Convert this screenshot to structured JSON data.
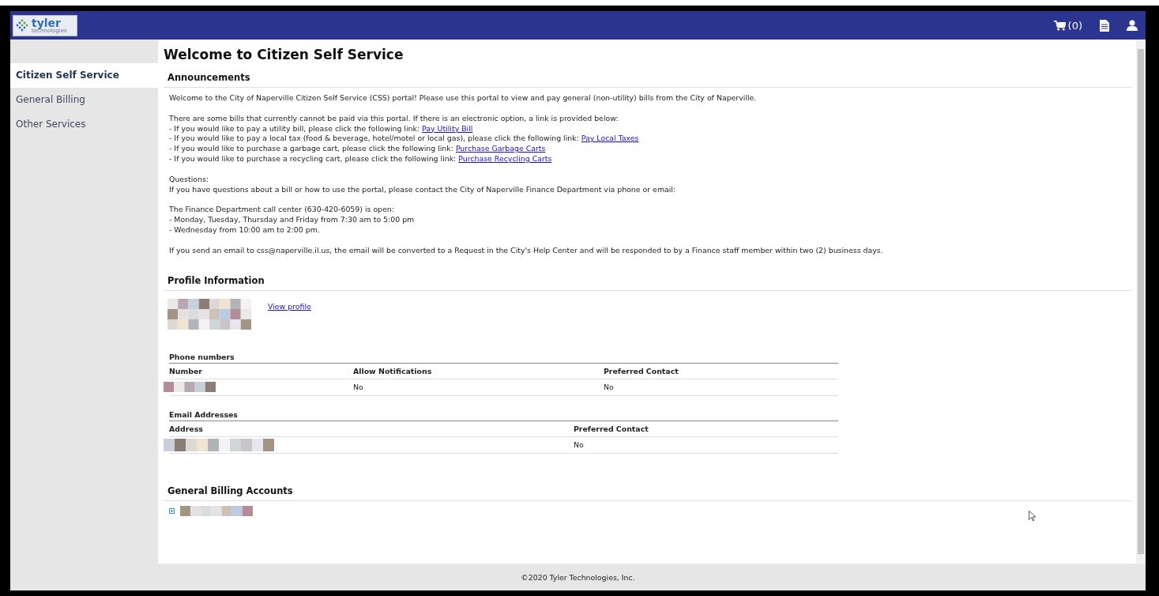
{
  "header": {
    "logo": "tyler",
    "logo_sub": "technologies",
    "cart_count": "(0)"
  },
  "sidebar": {
    "items": [
      {
        "label": "Citizen Self Service",
        "selected": true
      },
      {
        "label": "General Billing",
        "selected": false
      },
      {
        "label": "Other Services",
        "selected": false
      }
    ]
  },
  "page_title": "Welcome to Citizen Self Service",
  "announcements": {
    "heading": "Announcements",
    "paragraphs": [
      {
        "lines": [
          {
            "text": "Welcome to the City of Naperville Citizen Self Service (CSS) portal! Please use this portal to view and pay general (non-utility) bills from the City of Naperville."
          }
        ]
      },
      {
        "lines": [
          {
            "text": "There are some bills that currently cannot be paid via this portal. If there is an electronic option, a link is provided below:"
          },
          {
            "text": "- If you would like to pay a utility bill, please click the following link:",
            "link": "Pay Utility Bill"
          },
          {
            "text": "- If you would like to pay a local tax (food & beverage, hotel/motel or local gas), please click the following link:",
            "link": "Pay Local Taxes"
          },
          {
            "text": "- If you would like to purchase a garbage cart, please click the following link:",
            "link": "Purchase Garbage Carts"
          },
          {
            "text": "- If you would like to purchase a recycling cart, please click the following link:",
            "link": "Purchase Recycling Carts"
          }
        ]
      },
      {
        "lines": [
          {
            "text": "Questions:"
          },
          {
            "text": "If you have questions about a bill or how to use the portal, please contact the City of Naperville Finance Department via phone or email:"
          }
        ]
      },
      {
        "lines": [
          {
            "text": "The Finance Department call center (630-420-6059) is open:"
          },
          {
            "text": "- Monday, Tuesday, Thursday and Friday from 7:30 am to 5:00 pm"
          },
          {
            "text": "- Wednesday from 10:00 am to 2:00 pm."
          }
        ]
      },
      {
        "lines": [
          {
            "text": "If you send an email to css@naperville.il.us, the email will be converted to a Request in the City's Help Center and will be responded to by a Finance staff member within two (2) business days."
          }
        ]
      }
    ]
  },
  "profile": {
    "heading": "Profile Information",
    "view_link": "View profile",
    "phones": {
      "title": "Phone numbers",
      "columns": [
        "Number",
        "Allow Notifications",
        "Preferred Contact"
      ],
      "rows": [
        {
          "allow_notifications": "No",
          "preferred_contact": "No"
        }
      ]
    },
    "emails": {
      "title": "Email Addresses",
      "columns": [
        "Address",
        "Preferred Contact"
      ],
      "rows": [
        {
          "preferred_contact": "No"
        }
      ]
    }
  },
  "billing": {
    "heading": "General Billing Accounts",
    "accounts": [
      {
        "kind": "collapsed"
      }
    ]
  },
  "footer": "©2020 Tyler Technologies, Inc."
}
